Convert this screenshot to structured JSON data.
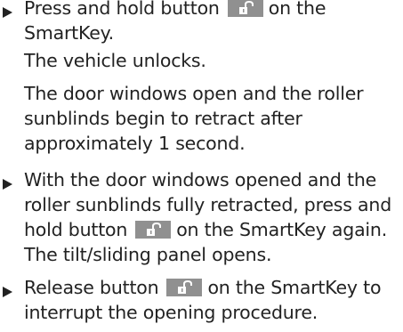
{
  "instructions": [
    {
      "lines": [
        {
          "before": "Press and hold button",
          "icon": "unlock-key-icon",
          "after": "on the"
        },
        {
          "text": "SmartKey."
        },
        {
          "text": "The vehicle unlocks."
        },
        {
          "text": "The door windows open and the roller"
        },
        {
          "text": "sunblinds begin to retract after"
        },
        {
          "text": "approximately 1 second."
        }
      ]
    },
    {
      "lines": [
        {
          "text": "With the door windows opened and the"
        },
        {
          "text": "roller sunblinds fully retracted, press and"
        },
        {
          "before": "hold button",
          "icon": "unlock-key-icon",
          "after": "on the SmartKey again."
        },
        {
          "text": "The tilt/sliding panel opens."
        }
      ]
    },
    {
      "lines": [
        {
          "before": "Release button",
          "icon": "unlock-key-icon",
          "after": "on the SmartKey to"
        },
        {
          "text": "interrupt the opening procedure."
        }
      ]
    }
  ],
  "colors": {
    "text": "#222222",
    "icon_background": "#909090",
    "icon_glyph": "#ffffff"
  }
}
